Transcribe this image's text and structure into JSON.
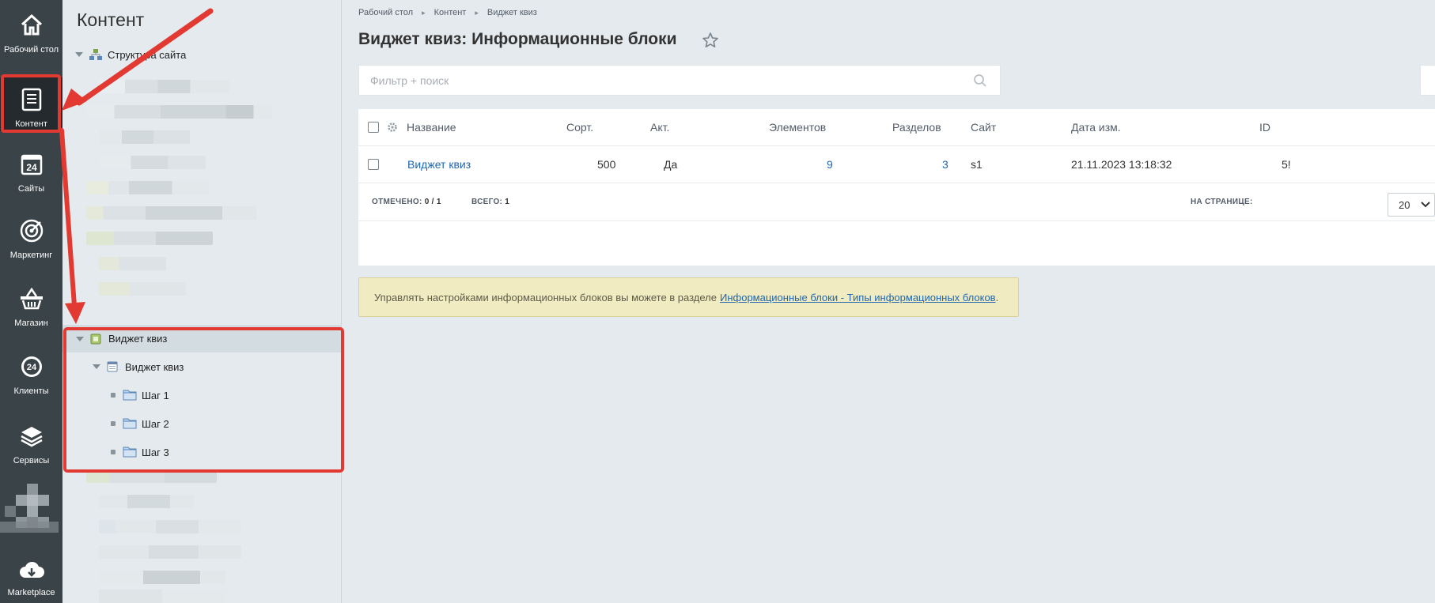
{
  "left_menu": {
    "items": [
      {
        "label": "Рабочий стол",
        "icon": "home-icon"
      },
      {
        "label": "Контент",
        "icon": "document-icon",
        "active": true
      },
      {
        "label": "Сайты",
        "icon": "calendar-24-icon"
      },
      {
        "label": "Маркетинг",
        "icon": "target-icon"
      },
      {
        "label": "Магазин",
        "icon": "basket-icon"
      },
      {
        "label": "Клиенты",
        "icon": "crm-24-icon"
      },
      {
        "label": "Сервисы",
        "icon": "layers-icon"
      },
      {
        "label": "Marketplace",
        "icon": "cloud-download-icon"
      }
    ]
  },
  "tree_panel": {
    "title": "Контент",
    "root": "Структура сайта",
    "iblock_type": "Виджет квиз",
    "iblock": "Виджет квиз",
    "sections": [
      "Шаг 1",
      "Шаг 2",
      "Шаг 3"
    ]
  },
  "breadcrumbs": [
    "Рабочий стол",
    "Контент",
    "Виджет квиз"
  ],
  "page_title": "Виджет квиз: Информационные блоки",
  "search": {
    "placeholder": "Фильтр + поиск"
  },
  "grid": {
    "columns": {
      "name": "Название",
      "sort": "Сорт.",
      "active": "Акт.",
      "elements": "Элементов",
      "sections": "Разделов",
      "site": "Сайт",
      "modified": "Дата изм.",
      "id": "ID"
    },
    "rows": [
      {
        "name": "Виджет квиз",
        "sort": "500",
        "active": "Да",
        "elements": "9",
        "sections": "3",
        "site": "s1",
        "modified": "21.11.2023 13:18:32",
        "id": "5!"
      }
    ],
    "footer": {
      "selected_label": "ОТМЕЧЕНО:",
      "selected_value": "0 / 1",
      "total_label": "ВСЕГО:",
      "total_value": "1",
      "per_page_label": "НА СТРАНИЦЕ:",
      "per_page_value": "20"
    }
  },
  "note": {
    "text": "Управлять настройками информационных блоков вы можете в разделе",
    "link_text": "Информационные блоки - Типы информационных блоков",
    "end": "."
  },
  "colors": {
    "accent": "#2067b0",
    "highlight": "#e23a33",
    "menu_bg": "#3a4347"
  }
}
